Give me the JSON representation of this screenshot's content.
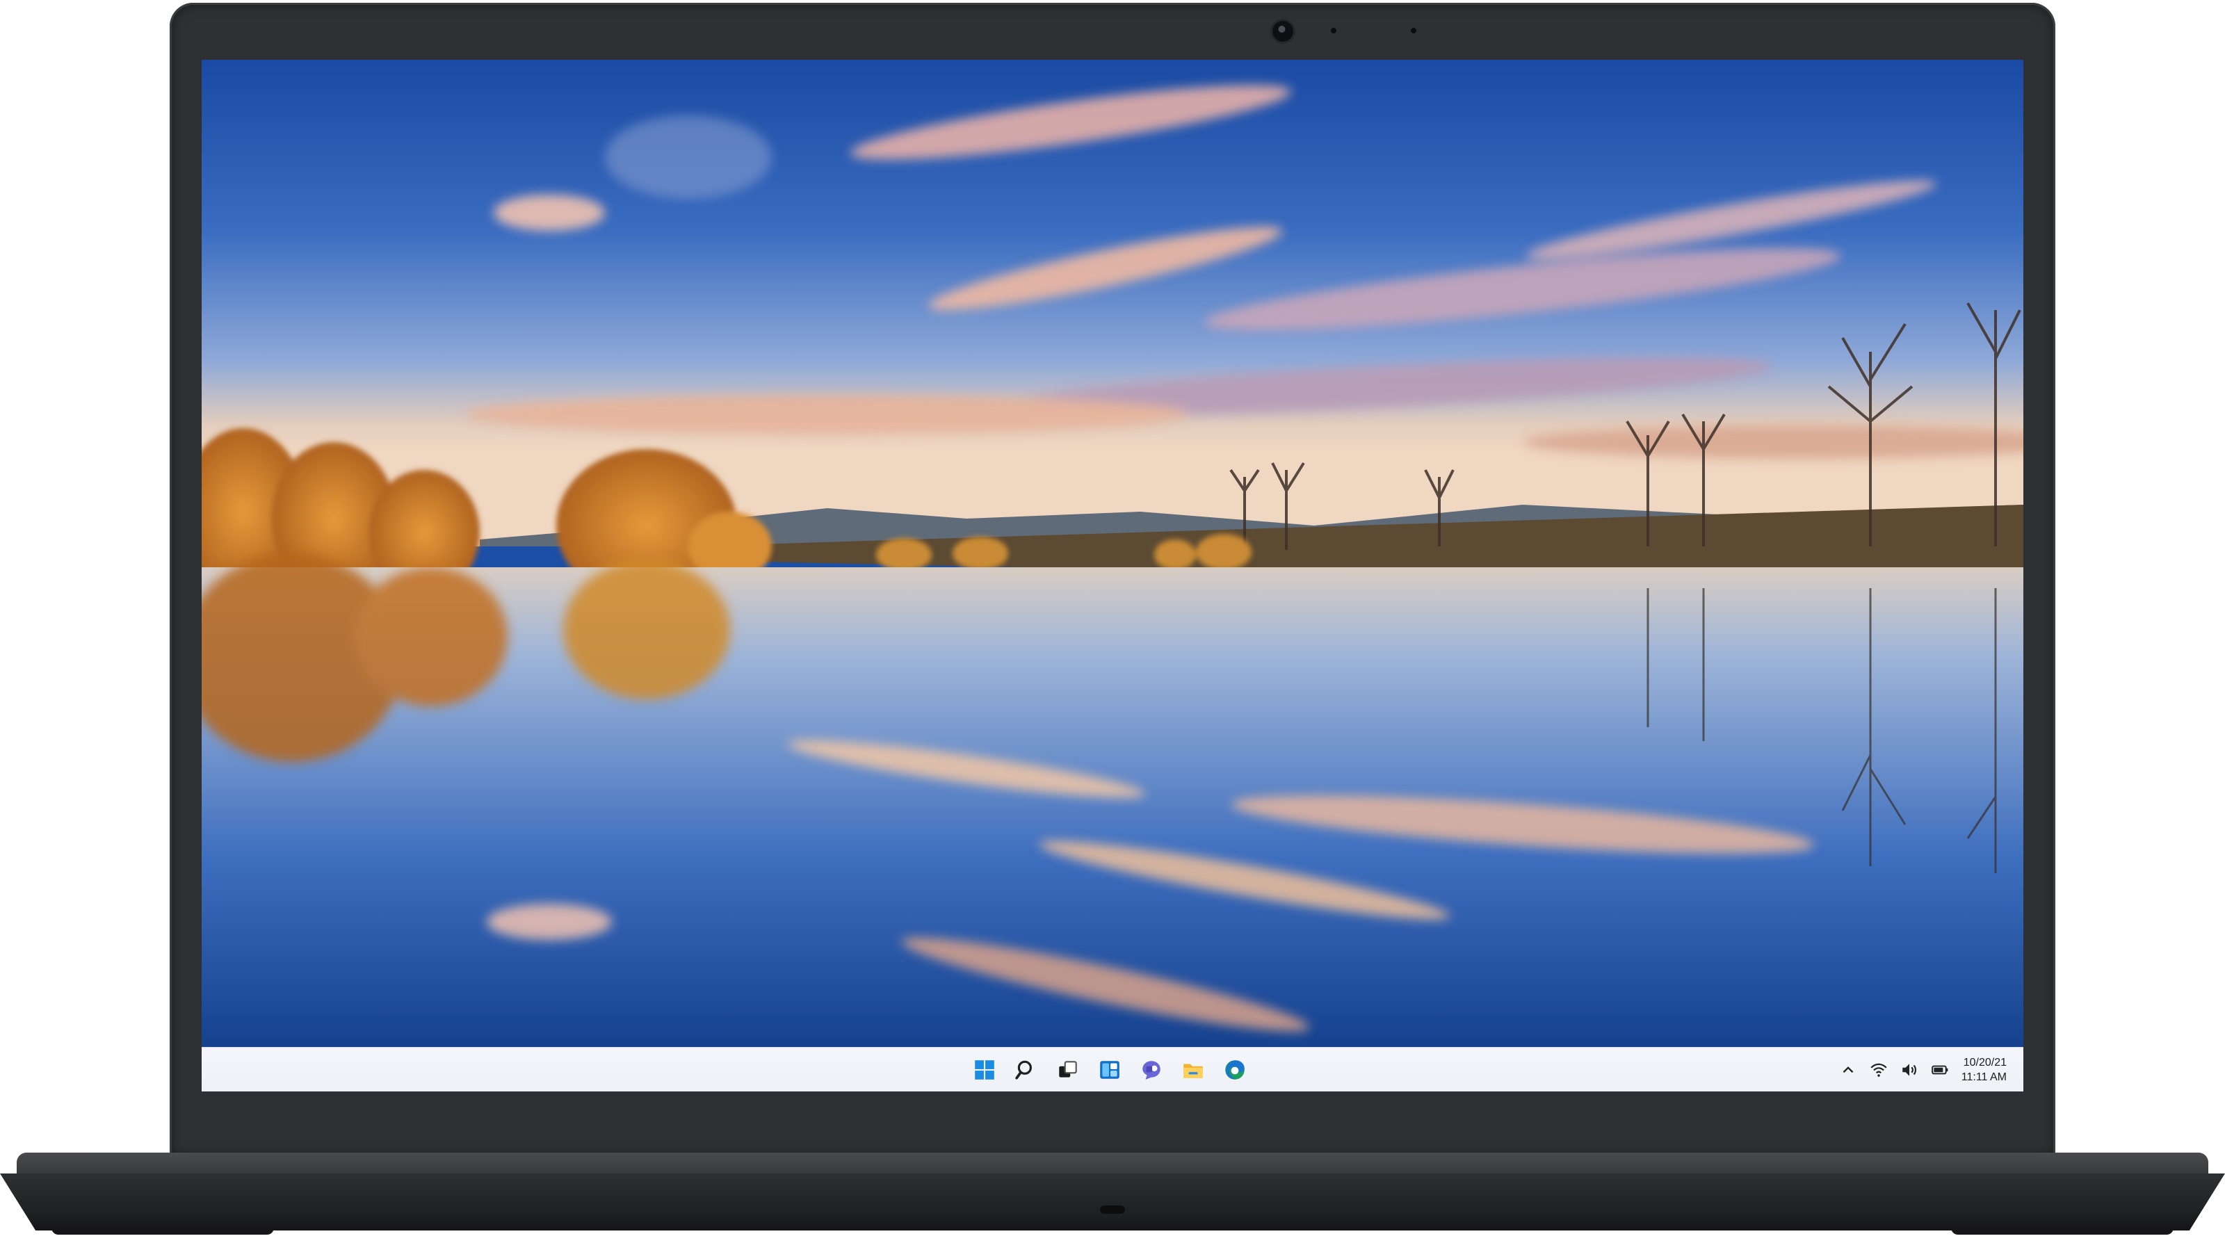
{
  "device": {
    "type": "laptop",
    "bezel_color": "#2f3033"
  },
  "desktop": {
    "wallpaper": "autumn lake reflection at sunset",
    "sky_colors": [
      "#1c4fa6",
      "#6a8fcf",
      "#e9b99c"
    ],
    "tree_color": "#c9751e"
  },
  "taskbar": {
    "pinned": [
      {
        "name": "start-button",
        "icon": "windows-start-icon"
      },
      {
        "name": "search-button",
        "icon": "search-icon"
      },
      {
        "name": "task-view-button",
        "icon": "task-view-icon"
      },
      {
        "name": "widgets-button",
        "icon": "widgets-icon"
      },
      {
        "name": "chat-button",
        "icon": "teams-chat-icon"
      },
      {
        "name": "file-explorer-button",
        "icon": "folder-icon"
      },
      {
        "name": "edge-button",
        "icon": "edge-browser-icon"
      }
    ],
    "tray": {
      "icons": [
        "chevron-up-icon",
        "wifi-icon",
        "volume-icon",
        "battery-icon"
      ],
      "date": "10/20/21",
      "time": "11:11 AM"
    },
    "accent": "#0078d4"
  }
}
